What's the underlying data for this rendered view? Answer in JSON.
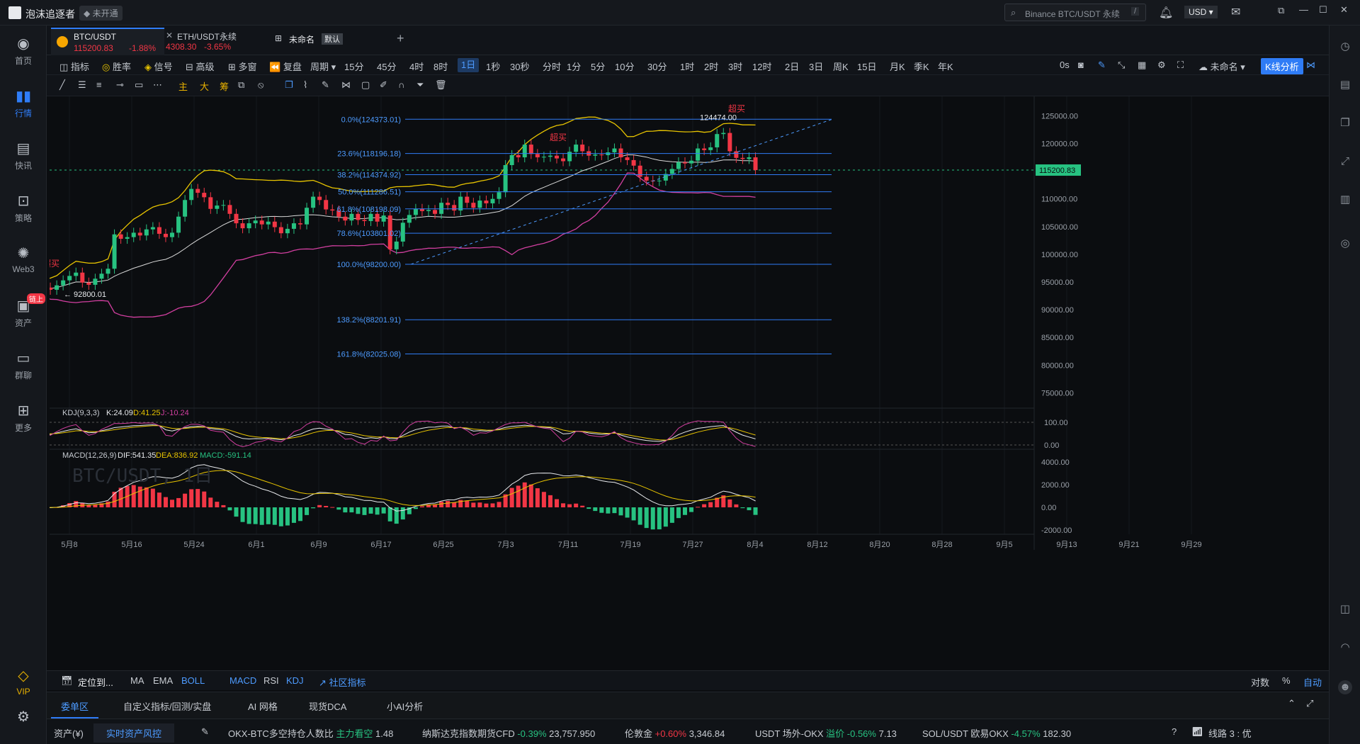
{
  "app": {
    "title": "泡沫追逐者",
    "status": "未开通",
    "search_placeholder": "Binance BTC/USDT 永续",
    "currency": "USD",
    "search_hint": "/"
  },
  "nav": [
    {
      "label": "首页",
      "icon": "home-icon"
    },
    {
      "label": "行情",
      "icon": "bar-chart-icon"
    },
    {
      "label": "快讯",
      "icon": "news-icon"
    },
    {
      "label": "策略",
      "icon": "robot-icon"
    },
    {
      "label": "Web3",
      "icon": "web3-icon"
    },
    {
      "label": "资产",
      "icon": "wallet-icon",
      "badge": "链上"
    },
    {
      "label": "群聊",
      "icon": "chat-icon"
    },
    {
      "label": "更多",
      "icon": "grid-icon"
    },
    {
      "label": "VIP",
      "icon": "diamond-icon"
    }
  ],
  "tabs": [
    {
      "symbol": "BTC/USDT",
      "price": "115200.83",
      "change": "-1.88%"
    },
    {
      "symbol": "ETH/USDT永续",
      "price": "4308.30",
      "change": "-3.65%"
    },
    {
      "name": "未命名",
      "badge": "默认"
    }
  ],
  "toolbar1": {
    "indicators": "指标",
    "winrate": "胜率",
    "signal": "信号",
    "advanced": "高级",
    "multi": "多窗",
    "replay": "复盘",
    "period": "周期",
    "intervals": [
      "15分",
      "45分",
      "4时",
      "8时",
      "1日",
      "1秒",
      "30秒",
      "分时",
      "1分",
      "5分",
      "10分",
      "30分",
      "1时",
      "2时",
      "3时",
      "12时",
      "2日",
      "3日",
      "周K",
      "15日",
      "月K",
      "季K",
      "年K"
    ],
    "selected": "1日",
    "countdown": "0s",
    "layout": "未命名",
    "kline": "K线分析"
  },
  "toolbar2": {
    "labels": [
      "主",
      "大",
      "筹"
    ]
  },
  "chart_data": {
    "type": "candlestick",
    "symbol_watermark": "BTC/USDT, 1日",
    "y_ticks": [
      "125000.00",
      "120000.00",
      "115000.00",
      "110000.00",
      "105000.00",
      "100000.00",
      "95000.00",
      "90000.00",
      "85000.00",
      "80000.00",
      "75000.00"
    ],
    "current_price": "115200.83",
    "x_ticks": [
      "5月8",
      "5月16",
      "5月24",
      "6月1",
      "6月9",
      "6月17",
      "6月25",
      "7月3",
      "7月11",
      "7月19",
      "7月27",
      "8月4",
      "8月12",
      "8月20",
      "8月28",
      "9月5",
      "9月13",
      "9月21",
      "9月29"
    ],
    "fib_levels": [
      {
        "label": "0.0%(124373.01)",
        "value": 124373.01
      },
      {
        "label": "23.6%(118196.18)",
        "value": 118196.18
      },
      {
        "label": "38.2%(114374.92)",
        "value": 114374.92
      },
      {
        "label": "50.0%(111286.51)",
        "value": 111286.51
      },
      {
        "label": "61.8%(108198.09)",
        "value": 108198.09
      },
      {
        "label": "78.6%(103801.02)",
        "value": 103801.02
      },
      {
        "label": "100.0%(98200.00)",
        "value": 98200.0
      },
      {
        "label": "138.2%(88201.91)",
        "value": 88201.91
      },
      {
        "label": "161.8%(82025.08)",
        "value": 82025.08
      }
    ],
    "annotations": {
      "high": "124474.00",
      "low": "92800.01",
      "overbought": "超买"
    },
    "kdj": {
      "label": "KDJ(9,3,3)",
      "k": "K:24.09",
      "d": "D:41.25",
      "j": "J:-10.24",
      "y_ticks": [
        "100.00",
        "0.00"
      ]
    },
    "macd": {
      "label": "MACD(12,26,9)",
      "dif": "DIF:541.35",
      "dea": "DEA:836.92",
      "macd": "MACD:-591.14",
      "y_ticks": [
        "4000.00",
        "2000.00",
        "0.00",
        "-2000.00"
      ]
    },
    "closes": [
      94000,
      93600,
      94400,
      95300,
      96100,
      96700,
      94900,
      94500,
      95600,
      96500,
      97400,
      103600,
      102800,
      103100,
      103900,
      103400,
      104500,
      104900,
      103700,
      103100,
      103900,
      106800,
      109800,
      111800,
      111100,
      110300,
      108200,
      108800,
      108900,
      107300,
      105600,
      104700,
      105600,
      106100,
      105400,
      105900,
      104900,
      103800,
      104600,
      105600,
      105400,
      108400,
      110400,
      109800,
      108100,
      107900,
      106800,
      106100,
      107300,
      106200,
      106000,
      107300,
      105900,
      107000,
      100900,
      102300,
      105700,
      107100,
      108200,
      107800,
      108000,
      107300,
      109300,
      108900,
      107900,
      110400,
      109300,
      108400,
      109700,
      109200,
      110000,
      111200,
      116100,
      117900,
      117500,
      119800,
      118100,
      117500,
      117600,
      117800,
      117300,
      116800,
      118500,
      119800,
      118600,
      117800,
      118000,
      117900,
      118400,
      119100,
      117500,
      117000,
      116000,
      114000,
      113300,
      113200,
      113300,
      114500,
      115400,
      116600,
      116400,
      116900,
      119100,
      118800,
      119300,
      121700,
      121900,
      118600,
      117400,
      117200,
      117500,
      115200
    ],
    "opens": [
      94600,
      94000,
      93600,
      94400,
      95300,
      96100,
      96700,
      94900,
      94500,
      95600,
      96500,
      97400,
      103600,
      102800,
      103100,
      103900,
      103400,
      104500,
      104900,
      103700,
      103100,
      103900,
      106800,
      109800,
      111800,
      111100,
      110300,
      108200,
      108800,
      108900,
      107300,
      105600,
      104700,
      105600,
      106100,
      105400,
      105900,
      104900,
      103800,
      104600,
      105600,
      105400,
      108400,
      110400,
      109800,
      108100,
      107900,
      106800,
      106100,
      107300,
      106200,
      106000,
      107300,
      105900,
      107000,
      100900,
      102300,
      105700,
      107100,
      108200,
      107800,
      108000,
      107300,
      109300,
      108900,
      107900,
      110400,
      109300,
      108400,
      109700,
      109200,
      110000,
      111200,
      116100,
      117900,
      117500,
      119800,
      118100,
      117500,
      117600,
      117800,
      117300,
      116800,
      118500,
      119800,
      118600,
      117800,
      118000,
      117900,
      118400,
      119100,
      117500,
      117000,
      116000,
      114000,
      113300,
      113200,
      113300,
      114500,
      115400,
      116600,
      116400,
      116900,
      119100,
      118800,
      119300,
      121700,
      121900,
      118600,
      117400,
      117200,
      117500
    ]
  }
}
